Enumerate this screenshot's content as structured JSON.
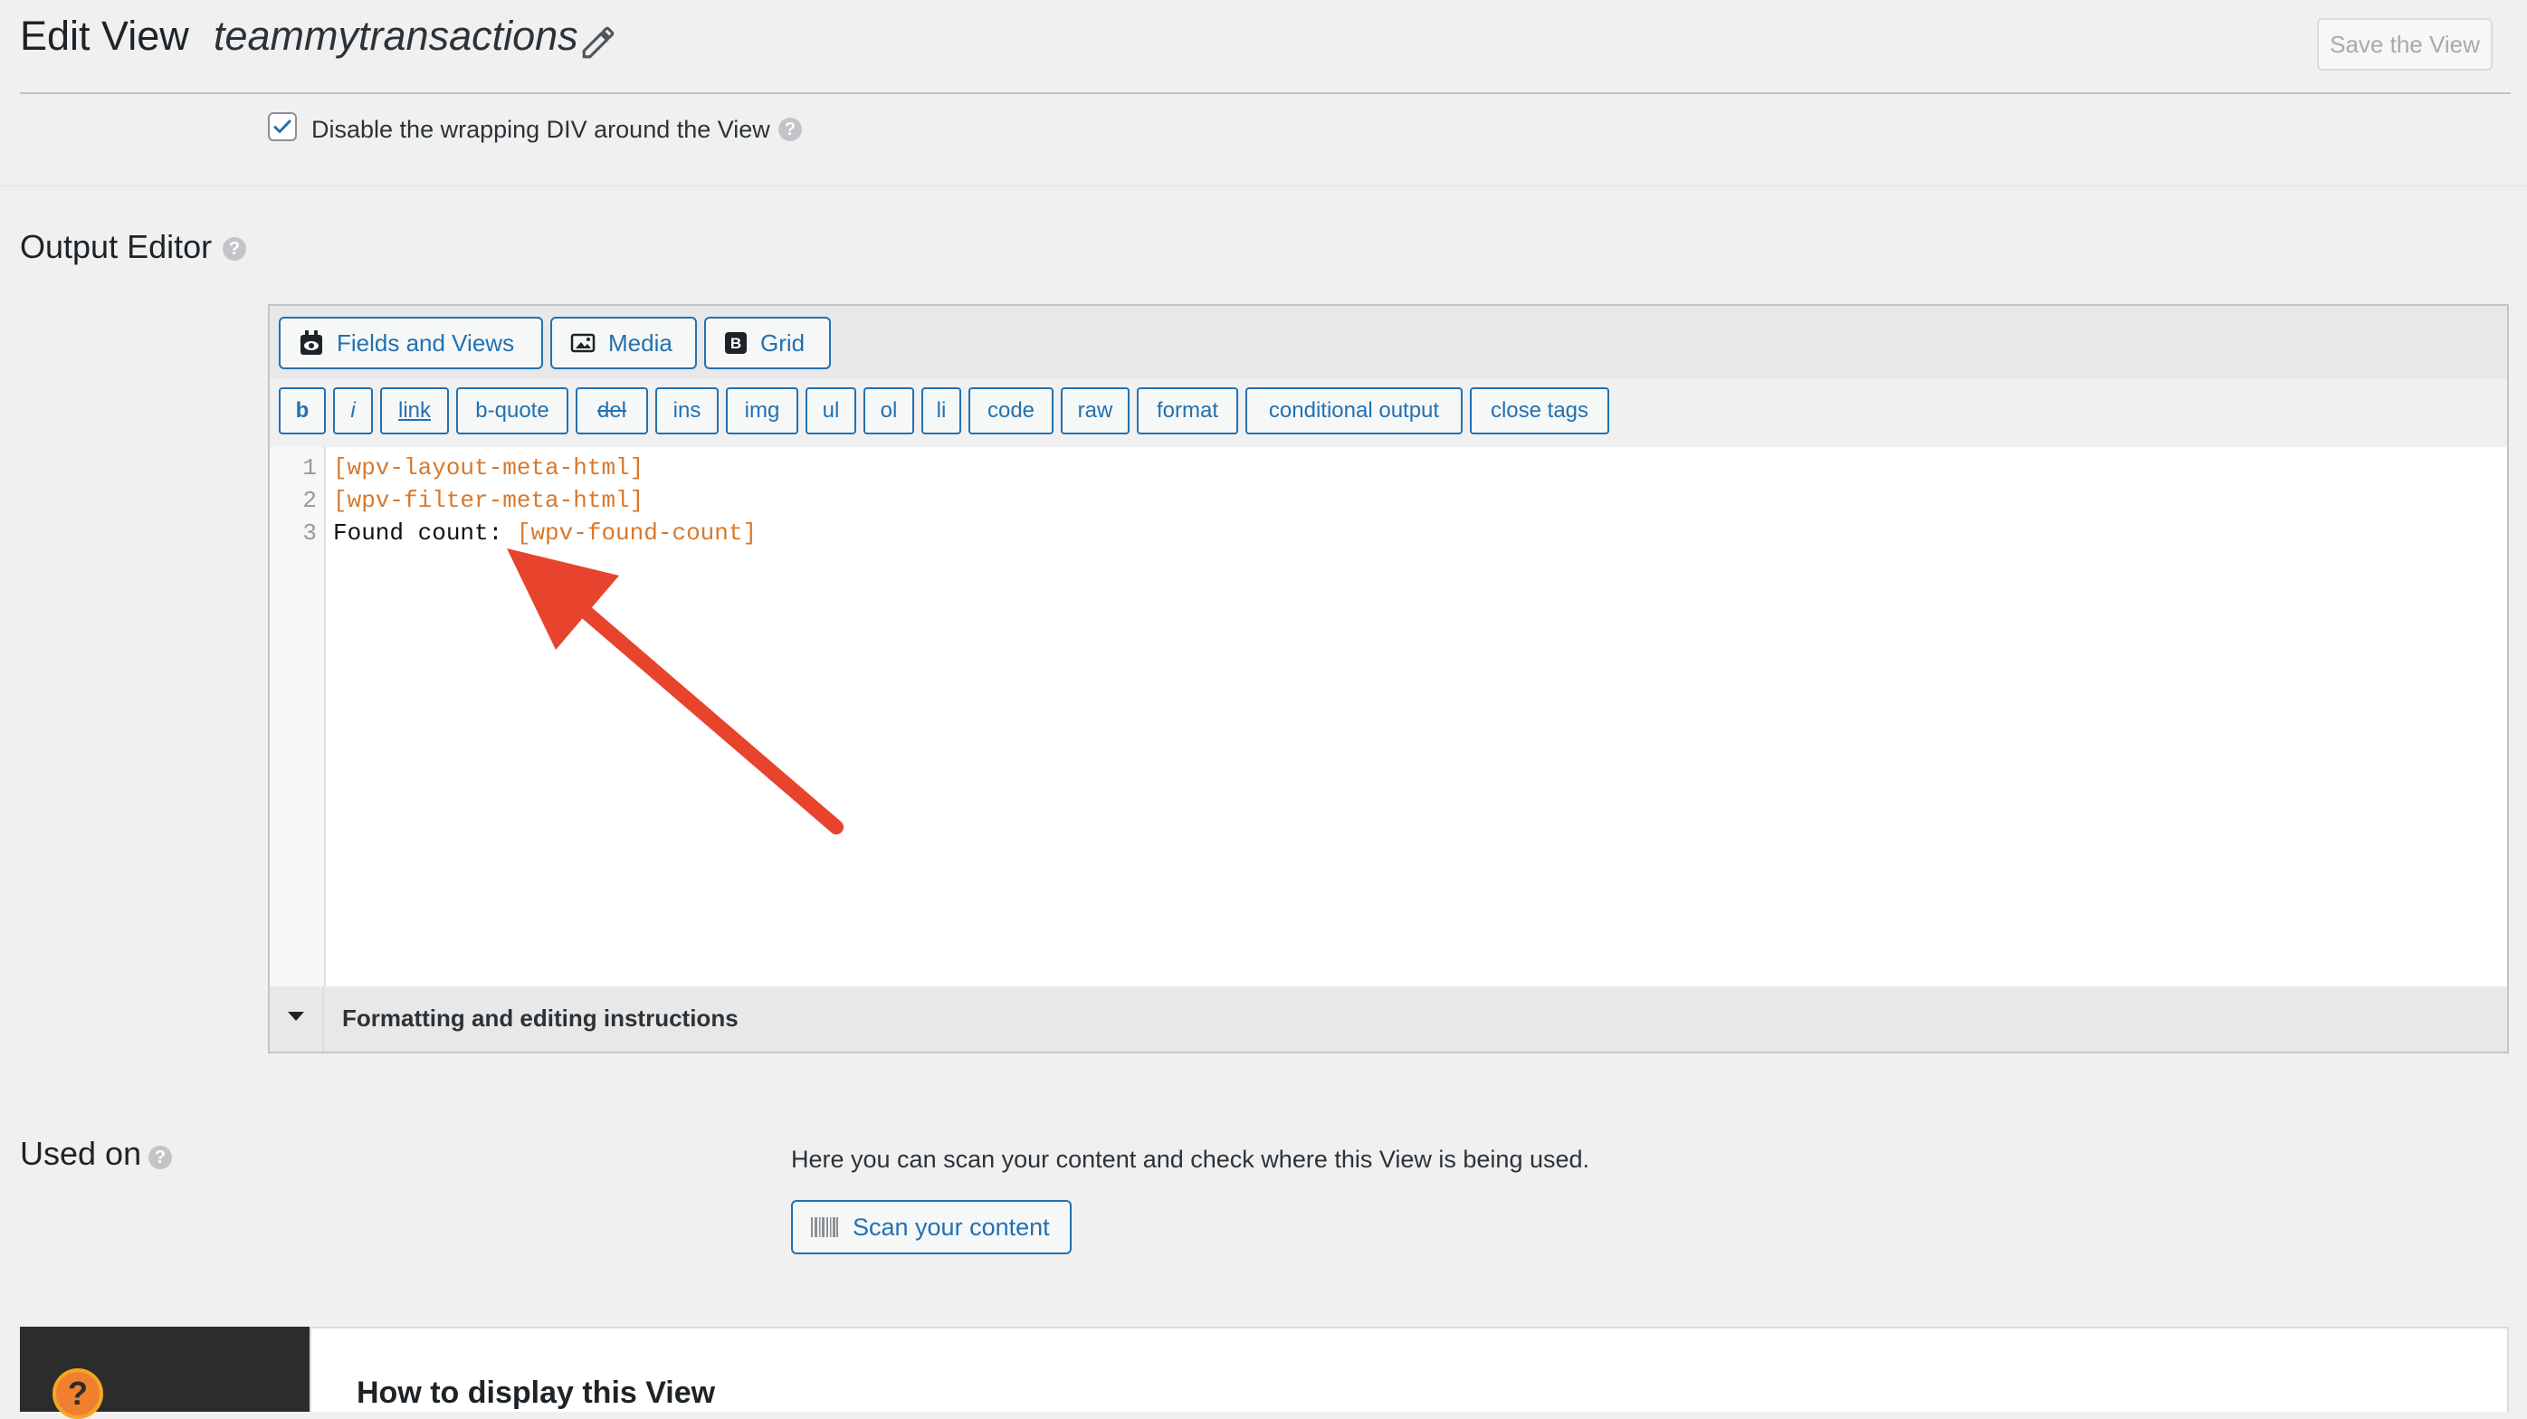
{
  "header": {
    "title": "Edit View",
    "view_name": "teammytransactions",
    "save_label": "Save the View"
  },
  "wrapping_option": {
    "label": "Disable the wrapping DIV around the View",
    "checked": true
  },
  "output_editor": {
    "title": "Output Editor",
    "toolbar_buttons": {
      "fields_and_views": "Fields and Views",
      "media": "Media",
      "grid": "Grid"
    },
    "quicktags": [
      "b",
      "i",
      "link",
      "b-quote",
      "del",
      "ins",
      "img",
      "ul",
      "ol",
      "li",
      "code",
      "raw",
      "format",
      "conditional output",
      "close tags"
    ],
    "line_numbers": [
      "1",
      "2",
      "3"
    ],
    "code": {
      "line1": "[wpv-layout-meta-html]",
      "line2": "[wpv-filter-meta-html]",
      "line3_text": "Found count: ",
      "line3_shortcode": "[wpv-found-count]"
    },
    "instructions_label": "Formatting and editing instructions"
  },
  "used_on": {
    "title": "Used on",
    "description": "Here you can scan your content and check where this View is being used.",
    "scan_label": "Scan your content"
  },
  "how_to": {
    "title": "How to display this View",
    "icon_glyph": "?"
  },
  "colors": {
    "accent": "#2271b1",
    "shortcode": "#d9782b",
    "arrow": "#e8432c",
    "dark_panel": "#2c2c2c",
    "help_orange": "#f08030"
  },
  "icons": [
    "pencil-icon",
    "help-icon",
    "fields-views-icon",
    "media-icon",
    "grid-icon",
    "triangle-down-icon",
    "barcode-icon",
    "question-icon"
  ]
}
